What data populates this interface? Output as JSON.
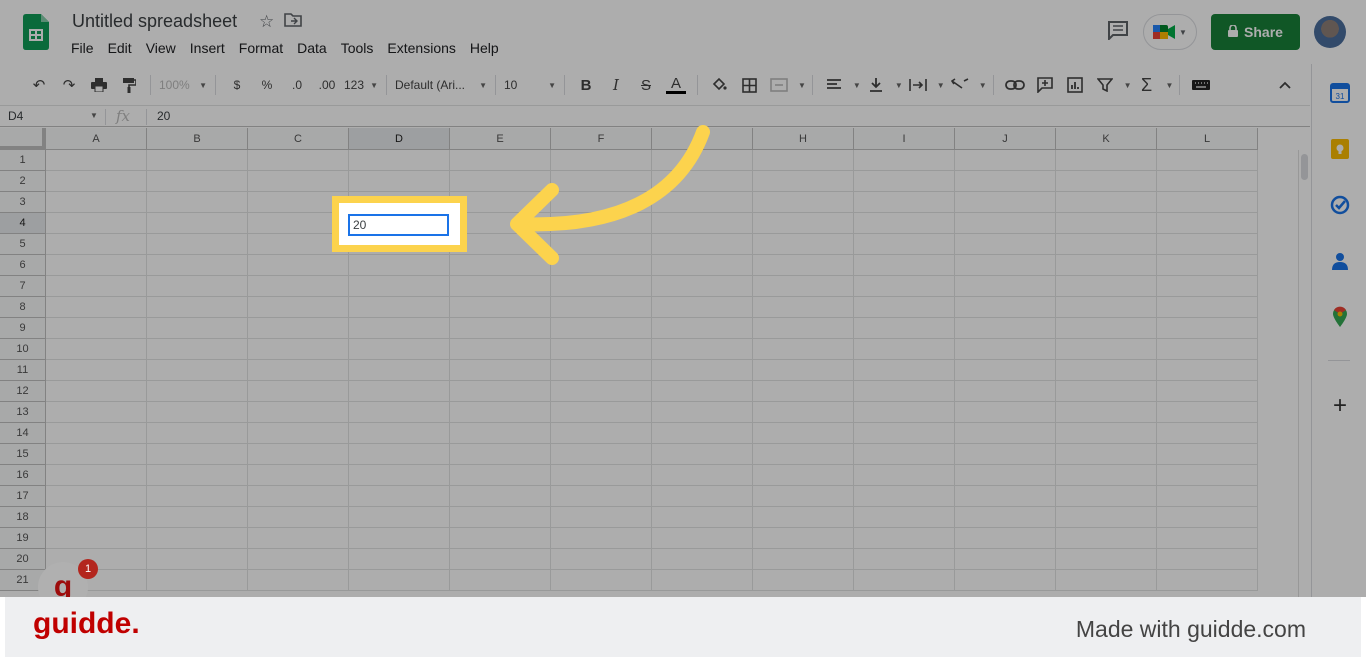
{
  "app": {
    "title": "Untitled spreadsheet",
    "menu": [
      "File",
      "Edit",
      "View",
      "Insert",
      "Format",
      "Data",
      "Tools",
      "Extensions",
      "Help"
    ],
    "share_label": "Share"
  },
  "toolbar": {
    "zoom": "100%",
    "currency": "$",
    "percent": "%",
    "dec_decrease": ".0",
    "dec_increase": ".00",
    "more_formats": "123",
    "font": "Default (Ari...",
    "font_size": "10",
    "bold": "B",
    "italic": "I",
    "strike": "S",
    "text_color": "A"
  },
  "formula_bar": {
    "name_box": "D4",
    "fx_label": "fx",
    "value": "20"
  },
  "grid": {
    "columns": [
      "A",
      "B",
      "C",
      "D",
      "E",
      "F",
      "G",
      "H",
      "I",
      "J",
      "K",
      "L"
    ],
    "rows": [
      "1",
      "2",
      "3",
      "4",
      "5",
      "6",
      "7",
      "8",
      "9",
      "10",
      "11",
      "12",
      "13",
      "14",
      "15",
      "16",
      "17",
      "18",
      "19",
      "20",
      "21"
    ],
    "selected_column": "D",
    "selected_row": "4",
    "active_cell_value": "20"
  },
  "overlay": {
    "badge_letter": "g",
    "badge_count": "1"
  },
  "footer": {
    "brand": "guidde.",
    "made_with": "Made with guidde.com"
  },
  "colors": {
    "accent": "#1a73e8",
    "share": "#188038",
    "highlight": "#fcd34d",
    "brand": "#c00000"
  }
}
